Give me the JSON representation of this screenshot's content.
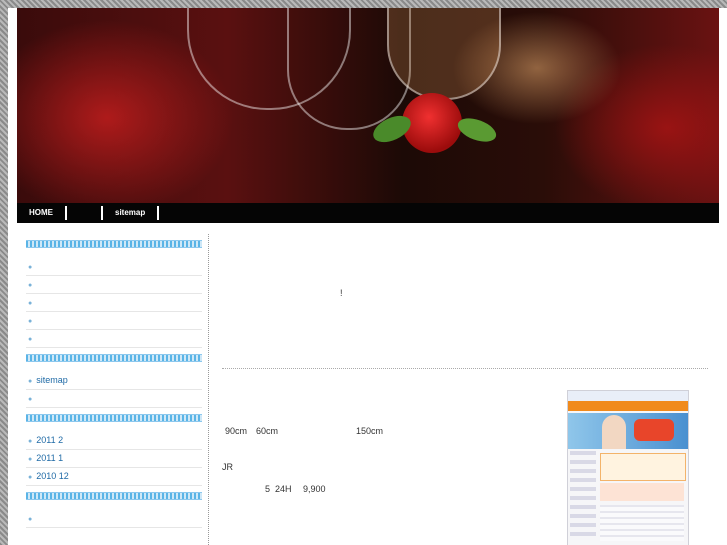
{
  "nav": {
    "items": [
      {
        "label": "HOME"
      },
      {
        "label": ""
      },
      {
        "label": "sitemap"
      }
    ]
  },
  "sidebar": {
    "group1": [
      "",
      "",
      "",
      "",
      ""
    ],
    "group2": [
      "sitemap",
      ""
    ],
    "group3": [
      "2011 2",
      "2011 1",
      "2010 12"
    ],
    "group4": [
      ""
    ]
  },
  "main": {
    "exclaim": "!",
    "line1_a": "90cm",
    "line1_b": "60cm",
    "line1_c": "150cm",
    "line2": "JR",
    "line3_a": "5",
    "line3_b": "24H",
    "line3_c": "9,900"
  },
  "colors": {
    "link": "#1f6aa6",
    "nav_bg": "#050505",
    "wavy_accent": "#5ab4e6"
  }
}
